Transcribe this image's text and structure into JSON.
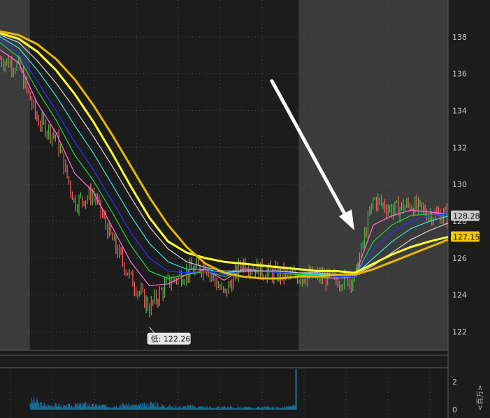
{
  "chart_data": [
    {
      "type": "line",
      "panel": "price",
      "ylim": [
        121,
        140
      ],
      "y_ticks": [
        122,
        124,
        126,
        128,
        130,
        132,
        134,
        136,
        138
      ],
      "y_tick_labels": [
        "122",
        "124",
        "126",
        "128",
        "130",
        "132",
        "134",
        "136",
        "138"
      ],
      "grid": true,
      "x": [
        0,
        5,
        10,
        15,
        20,
        25,
        30,
        35,
        40,
        45,
        50,
        55,
        60,
        65,
        70,
        75,
        80,
        85,
        90,
        95,
        100,
        105,
        110,
        115,
        120
      ],
      "series": [
        {
          "color": "#ff7a7a",
          "role": "price",
          "values": [
            136.8,
            136.4,
            133.5,
            132.6,
            129.0,
            129.5,
            127.0,
            124.9,
            123.3,
            124.7,
            125.2,
            125.6,
            124.0,
            125.8,
            125.3,
            125.1,
            125.0,
            125.0,
            124.8,
            124.9,
            129.2,
            128.6,
            128.9,
            128.4,
            128.3
          ]
        },
        {
          "color": "#ff66dd",
          "role": "ema-fast",
          "values": [
            137.3,
            136.6,
            134.4,
            132.8,
            130.6,
            129.6,
            127.7,
            125.8,
            124.5,
            124.6,
            125.1,
            125.4,
            124.8,
            125.4,
            125.3,
            125.2,
            125.1,
            125.0,
            124.9,
            125.0,
            127.8,
            128.3,
            128.6,
            128.5,
            128.4
          ]
        },
        {
          "color": "#22cc44",
          "role": "ema-2",
          "values": [
            137.7,
            136.9,
            135.1,
            133.5,
            131.6,
            130.2,
            128.5,
            126.7,
            125.3,
            124.9,
            125.1,
            125.3,
            125.0,
            125.3,
            125.3,
            125.2,
            125.1,
            125.1,
            125.0,
            125.0,
            126.9,
            127.8,
            128.3,
            128.4,
            128.4
          ]
        },
        {
          "color": "#2233ff",
          "role": "ema-3",
          "values": [
            137.9,
            137.1,
            135.6,
            134.0,
            132.3,
            130.8,
            129.1,
            127.4,
            126.0,
            125.3,
            125.2,
            125.3,
            125.1,
            125.3,
            125.3,
            125.2,
            125.2,
            125.1,
            125.0,
            125.0,
            126.5,
            127.4,
            128.0,
            128.3,
            128.4
          ]
        },
        {
          "color": "#33dddd",
          "role": "ema-4",
          "values": [
            138.0,
            137.4,
            136.2,
            134.8,
            133.2,
            131.7,
            130.0,
            128.3,
            126.8,
            125.8,
            125.4,
            125.4,
            125.2,
            125.3,
            125.3,
            125.3,
            125.2,
            125.1,
            125.1,
            125.1,
            126.0,
            126.9,
            127.6,
            128.0,
            128.28
          ]
        },
        {
          "color": "#cccccc",
          "role": "ema-5",
          "values": [
            138.1,
            137.7,
            136.7,
            135.5,
            134.1,
            132.6,
            131.0,
            129.3,
            127.7,
            126.5,
            125.8,
            125.5,
            125.3,
            125.3,
            125.3,
            125.3,
            125.2,
            125.2,
            125.1,
            125.1,
            125.6,
            126.3,
            127.0,
            127.5,
            127.9
          ]
        },
        {
          "color": "#ffff33",
          "role": "sma-slow",
          "values": [
            138.2,
            137.9,
            137.2,
            136.2,
            134.9,
            133.4,
            131.7,
            129.9,
            128.2,
            126.9,
            126.3,
            126.0,
            125.8,
            125.7,
            125.6,
            125.5,
            125.4,
            125.3,
            125.3,
            125.2,
            125.7,
            126.2,
            126.6,
            126.9,
            127.15
          ]
        },
        {
          "color": "#e8b800",
          "role": "sma-slowest",
          "values": [
            138.3,
            138.1,
            137.6,
            136.8,
            135.7,
            134.3,
            132.7,
            131.0,
            129.3,
            127.8,
            126.6,
            125.7,
            125.2,
            125.0,
            124.9,
            124.9,
            125.0,
            125.0,
            125.1,
            125.1,
            125.4,
            125.8,
            126.2,
            126.6,
            127.0
          ]
        }
      ],
      "badges": [
        {
          "label": "128.28",
          "value": 128.28,
          "color": "#c8c8c8"
        },
        {
          "label": "127.15",
          "value": 127.15,
          "color": "#f0c800"
        }
      ],
      "low_annotation": {
        "label": "低: 122.26",
        "x": 40,
        "value": 122.26
      },
      "session_shading": {
        "premarket_end_x": 8,
        "afterhours_start_x": 80
      }
    },
    {
      "type": "bar",
      "panel": "volume",
      "color": "#1b6f9a",
      "ylim": [
        0,
        3
      ],
      "y_ticks": [
        0,
        2
      ],
      "y_tick_labels": [
        "0",
        "2"
      ],
      "y_axis_label": "<百万>",
      "x": [
        8,
        10,
        12,
        14,
        16,
        18,
        20,
        22,
        24,
        26,
        28,
        30,
        32,
        34,
        36,
        38,
        40,
        42,
        44,
        46,
        48,
        50,
        52,
        54,
        56,
        58,
        60,
        62,
        64,
        66,
        68,
        70,
        72,
        74,
        76,
        78,
        79
      ],
      "values": [
        0.6,
        0.4,
        0.3,
        0.35,
        0.25,
        0.3,
        0.35,
        0.4,
        0.3,
        0.3,
        0.25,
        0.3,
        0.35,
        0.3,
        0.3,
        0.35,
        0.45,
        0.3,
        0.25,
        0.2,
        0.2,
        0.25,
        0.2,
        0.2,
        0.15,
        0.15,
        0.2,
        0.15,
        0.15,
        0.15,
        0.15,
        0.2,
        0.15,
        0.15,
        0.2,
        0.25,
        2.9
      ]
    }
  ]
}
